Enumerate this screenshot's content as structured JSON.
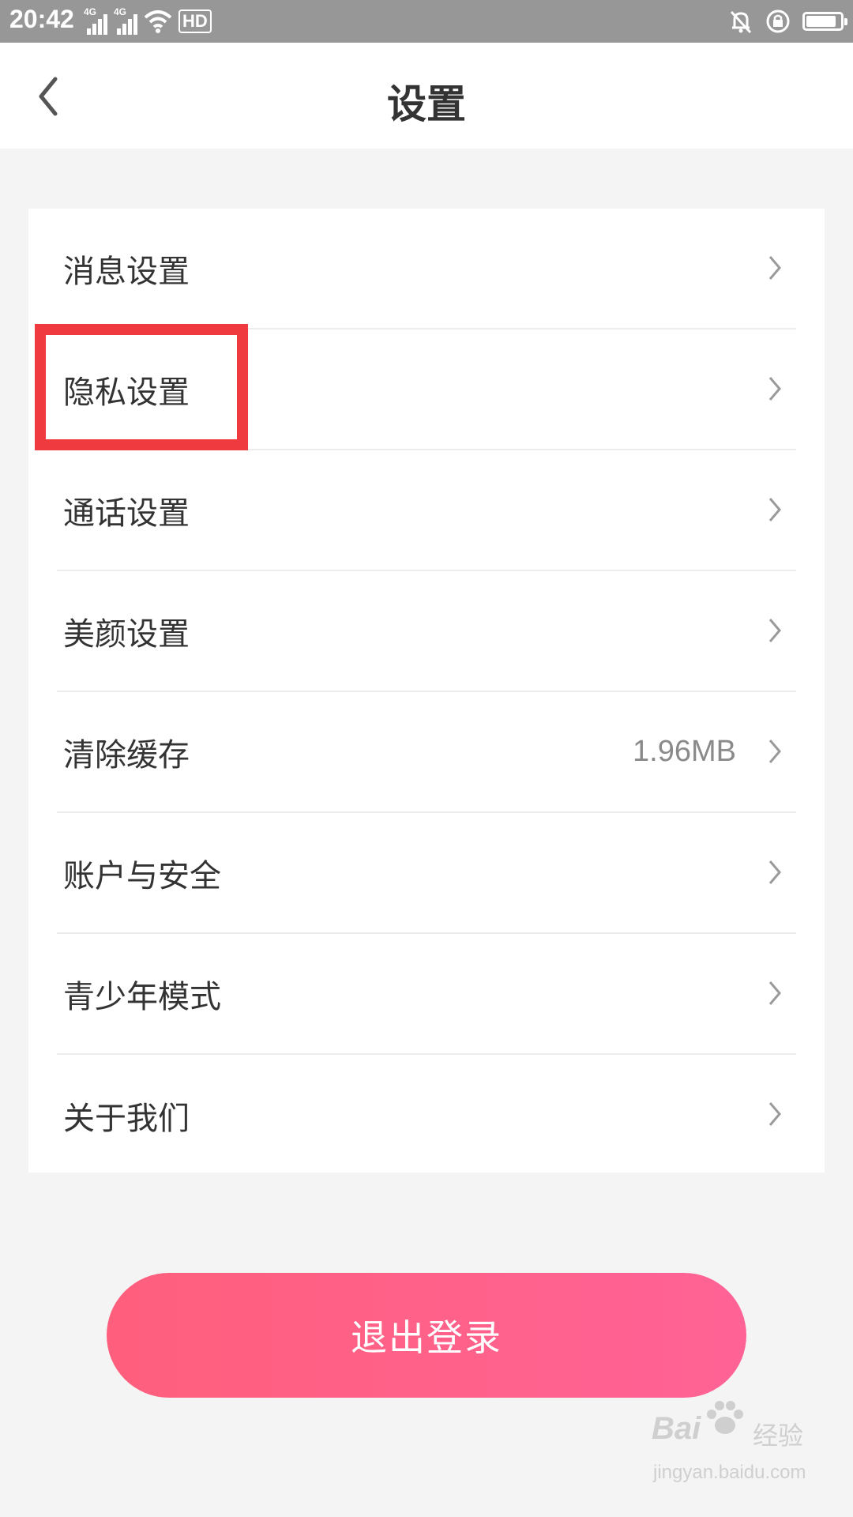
{
  "status_bar": {
    "time": "20:42",
    "network_1": "4G",
    "network_2": "4G",
    "hd_label": "HD",
    "battery_level": 0.9
  },
  "nav": {
    "title": "设置",
    "back_icon": "chevron-left-icon"
  },
  "settings": {
    "items": [
      {
        "label": "消息设置",
        "value": ""
      },
      {
        "label": "隐私设置",
        "value": ""
      },
      {
        "label": "通话设置",
        "value": ""
      },
      {
        "label": "美颜设置",
        "value": ""
      },
      {
        "label": "清除缓存",
        "value": "1.96MB"
      },
      {
        "label": "账户与安全",
        "value": ""
      },
      {
        "label": "青少年模式",
        "value": ""
      },
      {
        "label": "关于我们",
        "value": ""
      }
    ]
  },
  "logout": {
    "label": "退出登录"
  },
  "watermark": {
    "brand": "Bai",
    "brand_suffix": "经验",
    "url": "jingyan.baidu.com"
  },
  "colors": {
    "accent_start": "#ff5f7c",
    "accent_end": "#ff6396",
    "highlight": "#ef3a3f",
    "background": "#f4f4f4"
  }
}
